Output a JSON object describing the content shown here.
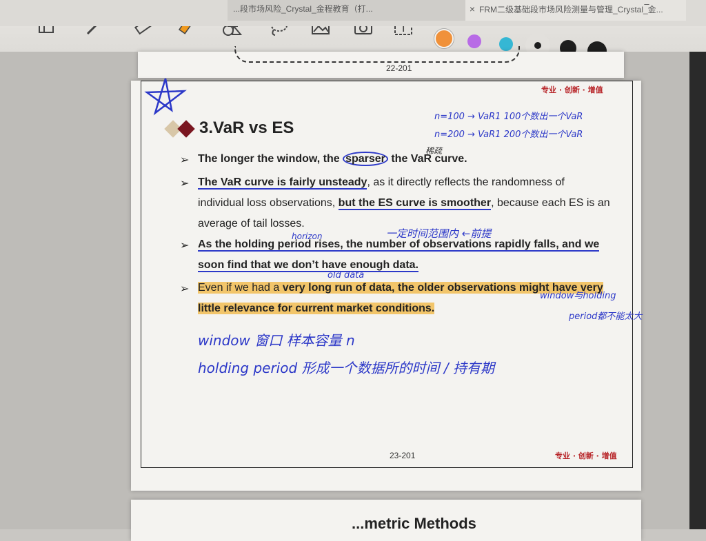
{
  "tabs": {
    "tab1_label": "...段市场风险_Crystal_金程教育（打...",
    "tab2_close": "×",
    "tab2_label": "FRM二级基础段市场风险测量与管理_Crystal_金..."
  },
  "toolbar": {
    "tools": [
      "layout-icon",
      "pen-icon",
      "eraser-icon",
      "highlighter-icon",
      "shapes-icon",
      "lasso-icon",
      "image-icon",
      "camera-icon",
      "text-icon"
    ],
    "colors": [
      "#f0913a",
      "#b86be6",
      "#35b7d4",
      "#1e1e1e",
      "#1e1e1e",
      "#1e1e1e"
    ],
    "bluetooth": "✱"
  },
  "prev_page": {
    "number": "22-201"
  },
  "slide": {
    "brand": "专业 · 创新 · 增值",
    "title": "3.VaR vs ES",
    "b1": {
      "t1": "The longer the window, the ",
      "t2": "sparser",
      "t3": " the VaR curve."
    },
    "b2": {
      "t1": "The VaR curve is fairly unsteady",
      "t2": ", as it directly reflects the randomness of individual loss observations, ",
      "t3": "but the ES curve is smoother",
      "t4": ", because each ES is an average of tail losses."
    },
    "b3": {
      "t1": "As the holding period rises, the number of observations rapidly falls, and we soon find that we don’t have enough data."
    },
    "b4": {
      "t1": "Even if we had a ",
      "t2": "very long run of data, the older observations might have very little relevance for current market conditions."
    },
    "page_number": "23-201",
    "brand_bottom": "专业 · 创新 · 增值"
  },
  "annotations": {
    "a1": "n=100 → VaR1   100个数出一个VaR",
    "a2": "n=200 → VaR1   200个数出一个VaR",
    "a3": "稀疏",
    "a4": "horizon",
    "a5": "一定时间范围内  ←前提",
    "a6": "old data",
    "a7": "window与holding",
    "a8": "period都不能太大",
    "a9": "window  窗口    样本容量 n",
    "a10": "holding period   形成一个数据所的时间 / 持有期"
  },
  "next_page": {
    "title": "...metric Methods"
  }
}
